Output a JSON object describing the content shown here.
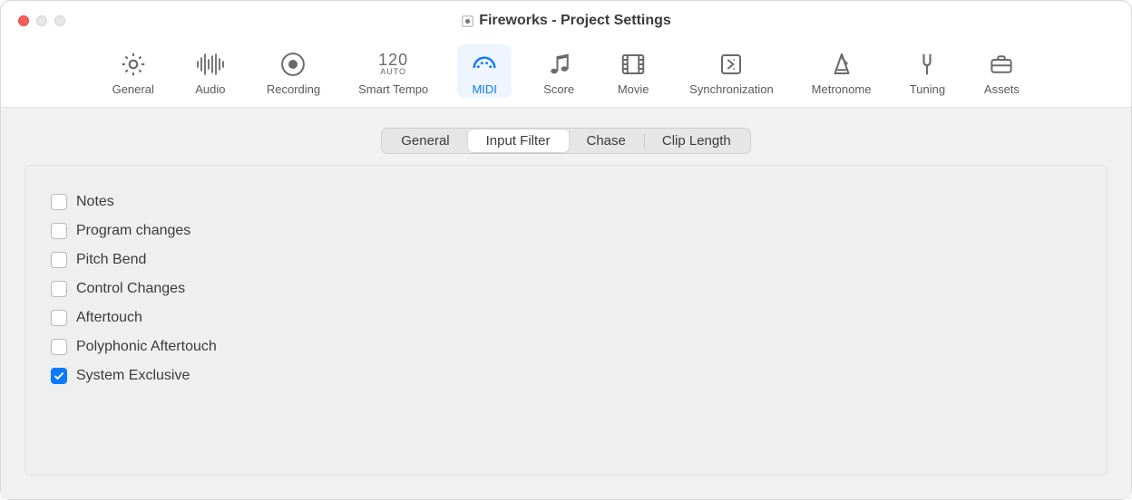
{
  "window": {
    "title": "Fireworks - Project Settings"
  },
  "toolbar": {
    "items": [
      {
        "id": "general",
        "label": "General"
      },
      {
        "id": "audio",
        "label": "Audio"
      },
      {
        "id": "recording",
        "label": "Recording"
      },
      {
        "id": "smart-tempo",
        "label": "Smart Tempo",
        "big": "120",
        "small": "AUTO"
      },
      {
        "id": "midi",
        "label": "MIDI"
      },
      {
        "id": "score",
        "label": "Score"
      },
      {
        "id": "movie",
        "label": "Movie"
      },
      {
        "id": "synchronization",
        "label": "Synchronization"
      },
      {
        "id": "metronome",
        "label": "Metronome"
      },
      {
        "id": "tuning",
        "label": "Tuning"
      },
      {
        "id": "assets",
        "label": "Assets"
      }
    ],
    "selected": "midi"
  },
  "segmented": {
    "tabs": [
      {
        "id": "general",
        "label": "General"
      },
      {
        "id": "input-filter",
        "label": "Input Filter"
      },
      {
        "id": "chase",
        "label": "Chase"
      },
      {
        "id": "clip-length",
        "label": "Clip Length"
      }
    ],
    "active": "input-filter"
  },
  "checkboxes": [
    {
      "id": "notes",
      "label": "Notes",
      "checked": false
    },
    {
      "id": "program-changes",
      "label": "Program changes",
      "checked": false
    },
    {
      "id": "pitch-bend",
      "label": "Pitch Bend",
      "checked": false
    },
    {
      "id": "control-changes",
      "label": "Control Changes",
      "checked": false
    },
    {
      "id": "aftertouch",
      "label": "Aftertouch",
      "checked": false
    },
    {
      "id": "polyphonic-aftertouch",
      "label": "Polyphonic Aftertouch",
      "checked": false
    },
    {
      "id": "system-exclusive",
      "label": "System Exclusive",
      "checked": true
    }
  ]
}
